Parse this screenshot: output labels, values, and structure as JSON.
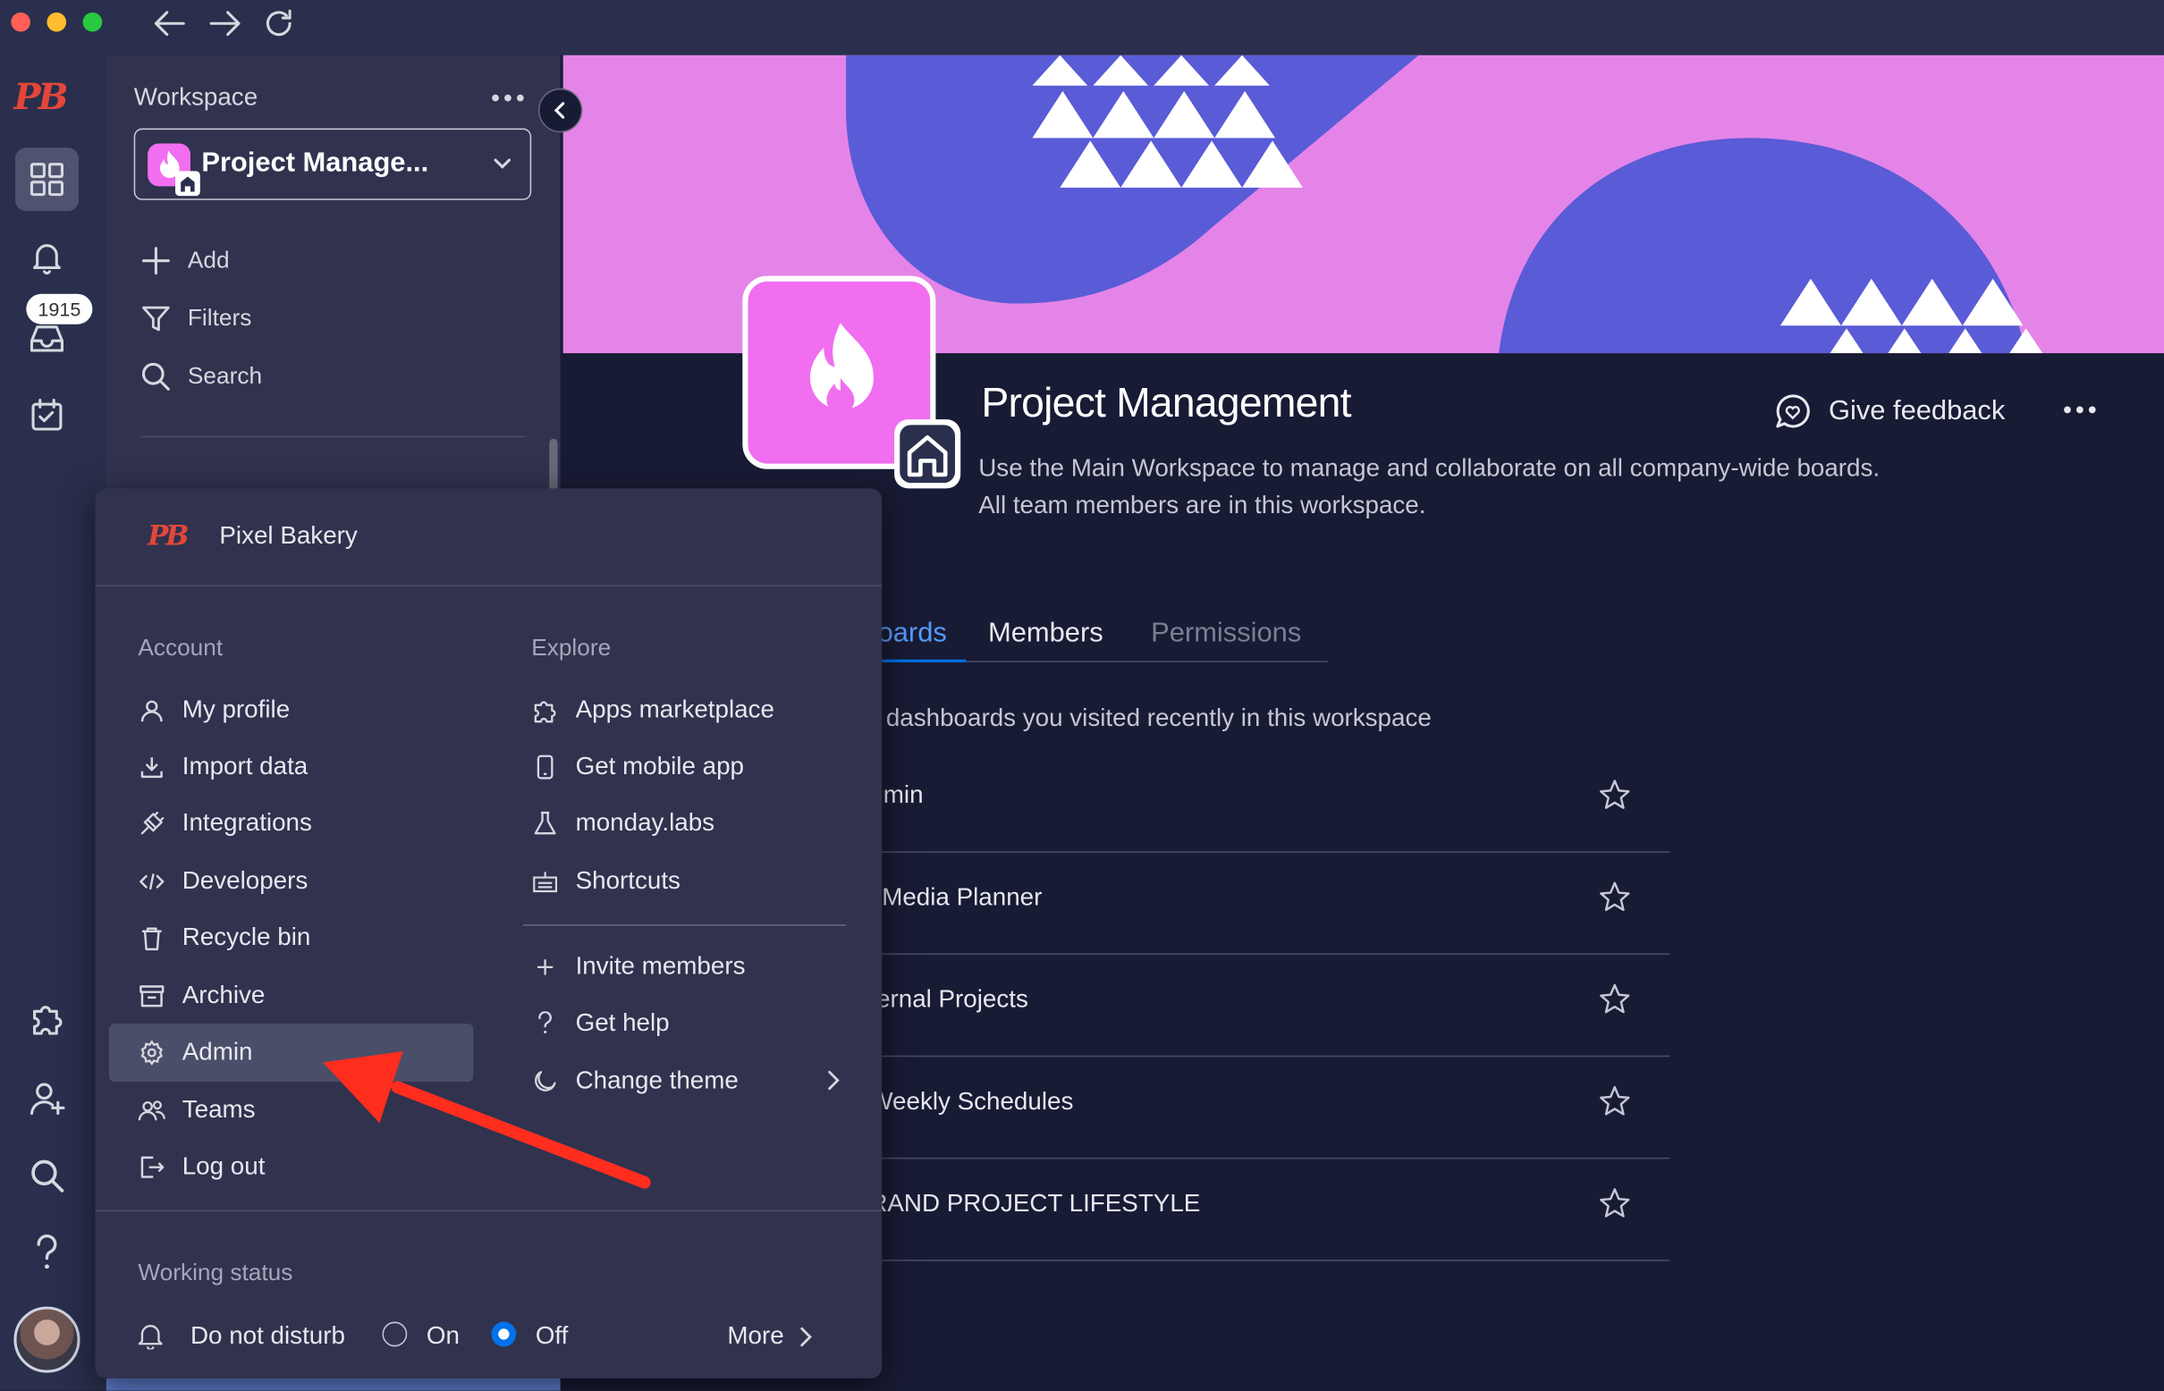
{
  "titlebar": {
    "traffic_lights": [
      "#ff5f57",
      "#febc2e",
      "#28c840"
    ]
  },
  "rail": {
    "logo_text": "PB",
    "badge_count": "1915"
  },
  "workspace_panel": {
    "header": "Workspace",
    "selector_label": "Project Manage...",
    "actions": [
      {
        "label": "Add",
        "icon": "plus-icon"
      },
      {
        "label": "Filters",
        "icon": "filter-icon"
      },
      {
        "label": "Search",
        "icon": "search-icon"
      }
    ]
  },
  "main": {
    "title": "Project Management",
    "description_line1": "Use the Main Workspace to manage and collaborate on all company-wide boards.",
    "description_line2": "All team members are in this workspace.",
    "feedback_label": "Give feedback",
    "tabs": [
      {
        "label": "oards",
        "active": true
      },
      {
        "label": "Members",
        "active": false
      },
      {
        "label": "Permissions",
        "active": false
      }
    ],
    "recent_text": "d dashboards you visited recently in this workspace",
    "boards": [
      "dmin",
      "l Media Planner",
      "ternal Projects",
      " Weekly Schedules",
      "RAND PROJECT LIFESTYLE"
    ]
  },
  "menu": {
    "account_name": "Pixel Bakery",
    "account_header": "Account",
    "explore_header": "Explore",
    "account_items": [
      {
        "label": "My profile",
        "icon": "person-icon"
      },
      {
        "label": "Import data",
        "icon": "download-icon"
      },
      {
        "label": "Integrations",
        "icon": "plug-icon"
      },
      {
        "label": "Developers",
        "icon": "code-icon"
      },
      {
        "label": "Recycle bin",
        "icon": "trash-icon"
      },
      {
        "label": "Archive",
        "icon": "archive-icon"
      },
      {
        "label": "Admin",
        "icon": "gear-icon"
      },
      {
        "label": "Teams",
        "icon": "team-icon"
      },
      {
        "label": "Log out",
        "icon": "logout-icon"
      }
    ],
    "explore_items": [
      {
        "label": "Apps marketplace",
        "icon": "puzzle-icon"
      },
      {
        "label": "Get mobile app",
        "icon": "mobile-icon"
      },
      {
        "label": "monday.labs",
        "icon": "flask-icon"
      },
      {
        "label": "Shortcuts",
        "icon": "keyboard-icon"
      }
    ],
    "more_items": [
      {
        "label": "Invite members",
        "icon": "plus-icon"
      },
      {
        "label": "Get help",
        "icon": "question-icon"
      },
      {
        "label": "Change theme",
        "icon": "moon-icon"
      }
    ],
    "working_status_header": "Working status",
    "dnd_label": "Do not disturb",
    "on_label": "On",
    "off_label": "Off",
    "dnd_selected": "Off",
    "more_label": "More"
  },
  "colors": {
    "accent": "#0073ea",
    "annotation_arrow": "#ff2d1e",
    "workspace_icon": "#f06eef",
    "banner": "#e484e9",
    "banner_shape": "#5a5bd6"
  }
}
